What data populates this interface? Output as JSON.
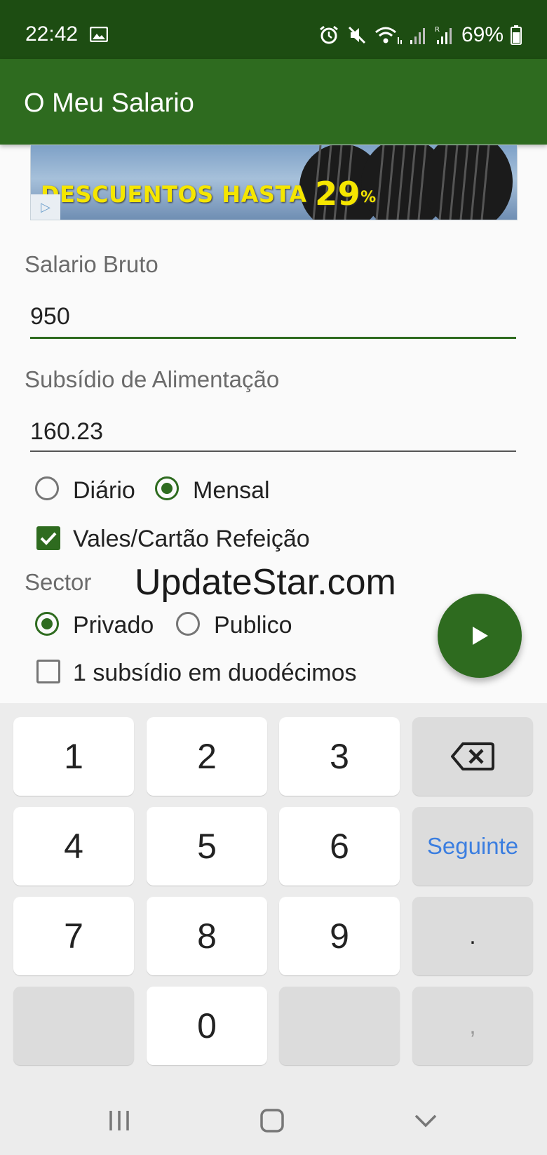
{
  "status_bar": {
    "time": "22:42",
    "battery": "69%",
    "icons": [
      "gallery-icon",
      "alarm-icon",
      "mute-icon",
      "wifi-icon",
      "signal-icon",
      "signal-roaming-icon",
      "battery-icon"
    ]
  },
  "app_bar": {
    "title": "O Meu Salario"
  },
  "ad": {
    "text": "DESCUENTOS HASTA",
    "percent": "29",
    "percent_sign": "%"
  },
  "form": {
    "salario_bruto": {
      "label": "Salario Bruto",
      "value": "950"
    },
    "subsidio": {
      "label": "Subsídio de Alimentação",
      "value": "160.23"
    },
    "frequency": {
      "options": [
        "Diário",
        "Mensal"
      ],
      "selected": "Mensal"
    },
    "vales_checkbox": {
      "label": "Vales/Cartão Refeição",
      "checked": true
    },
    "sector": {
      "label": "Sector",
      "options": [
        "Privado",
        "Publico"
      ],
      "selected": "Privado"
    },
    "duodecimos_checkbox": {
      "label": "1 subsídio em duodécimos",
      "checked": false
    }
  },
  "watermark": "UpdateStar.com",
  "fab_icon": "play-icon",
  "keyboard": {
    "keys": [
      "1",
      "2",
      "3",
      "4",
      "5",
      "6",
      "7",
      "8",
      "9",
      "0"
    ],
    "next_label": "Seguinte",
    "dot_label": ".",
    "comma_label": ","
  },
  "colors": {
    "status_bar": "#1d4d12",
    "app_bar": "#2e6b1f",
    "accent": "#2e6b1f",
    "keyboard_action": "#3b7ee0"
  }
}
